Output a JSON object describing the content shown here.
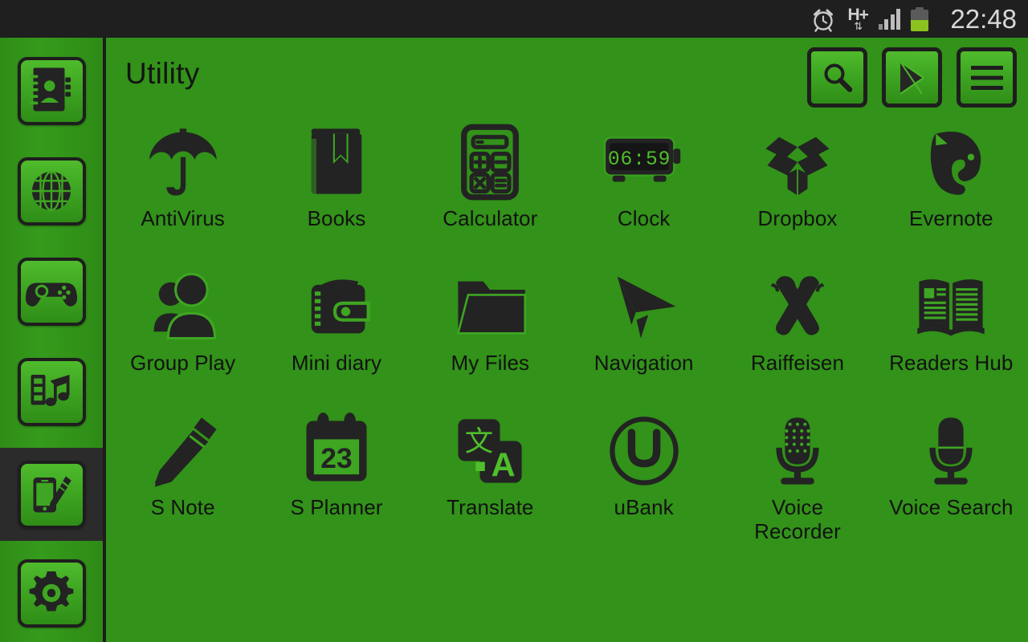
{
  "statusbar": {
    "time": "22:48",
    "network_type": "H+",
    "icons": [
      "alarm-clock-icon",
      "hplus-data-icon",
      "signal-bars-icon",
      "battery-icon"
    ],
    "battery_level_pct": 50,
    "signal_bars": 4,
    "background_color": "#1f1f1f",
    "text_color": "#d8d8d8"
  },
  "theme": {
    "background_green": "#329219",
    "tile_green_light": "#4fbb2c",
    "tile_green_dark": "#2f8d17",
    "icon_dark": "#232323",
    "selected_background": "#2b2b2b",
    "battery_green": "#8bc220"
  },
  "sidebar": {
    "items": [
      {
        "label": "Contacts",
        "icon": "contacts-book-icon",
        "selected": false
      },
      {
        "label": "Internet",
        "icon": "globe-icon",
        "selected": false
      },
      {
        "label": "Games",
        "icon": "gamepad-icon",
        "selected": false
      },
      {
        "label": "Music",
        "icon": "music-library-icon",
        "selected": false
      },
      {
        "label": "Apps",
        "icon": "phone-pen-icon",
        "selected": true
      },
      {
        "label": "Settings",
        "icon": "gear-icon",
        "selected": false
      }
    ]
  },
  "header": {
    "title": "Utility",
    "actions": [
      {
        "label": "Search",
        "icon": "search-icon"
      },
      {
        "label": "Play Store",
        "icon": "play-store-icon"
      },
      {
        "label": "Menu",
        "icon": "hamburger-menu-icon"
      }
    ]
  },
  "app_grid": {
    "columns": 6,
    "apps": [
      {
        "label": "AntiVirus",
        "icon": "umbrella-icon"
      },
      {
        "label": "Books",
        "icon": "book-bookmark-icon"
      },
      {
        "label": "Calculator",
        "icon": "calculator-icon"
      },
      {
        "label": "Clock",
        "icon": "digital-clock-icon",
        "display_time": "06:59"
      },
      {
        "label": "Dropbox",
        "icon": "open-box-icon"
      },
      {
        "label": "Evernote",
        "icon": "elephant-icon"
      },
      {
        "label": "Group Play",
        "icon": "two-people-icon"
      },
      {
        "label": "Mini diary",
        "icon": "wallet-icon"
      },
      {
        "label": "My Files",
        "icon": "folder-icon"
      },
      {
        "label": "Navigation",
        "icon": "paper-plane-icon"
      },
      {
        "label": "Raiffeisen",
        "icon": "crossed-gable-icon"
      },
      {
        "label": "Readers Hub",
        "icon": "open-book-icon"
      },
      {
        "label": "S Note",
        "icon": "pen-icon"
      },
      {
        "label": "S Planner",
        "icon": "calendar-icon",
        "display_date": "23"
      },
      {
        "label": "Translate",
        "icon": "translate-icon",
        "glyph_source": "文",
        "glyph_target": "A"
      },
      {
        "label": "uBank",
        "icon": "ubank-u-circle-icon",
        "glyph": "U"
      },
      {
        "label": "Voice Recorder",
        "icon": "microphone-dotted-icon"
      },
      {
        "label": "Voice Search",
        "icon": "microphone-icon"
      }
    ]
  }
}
